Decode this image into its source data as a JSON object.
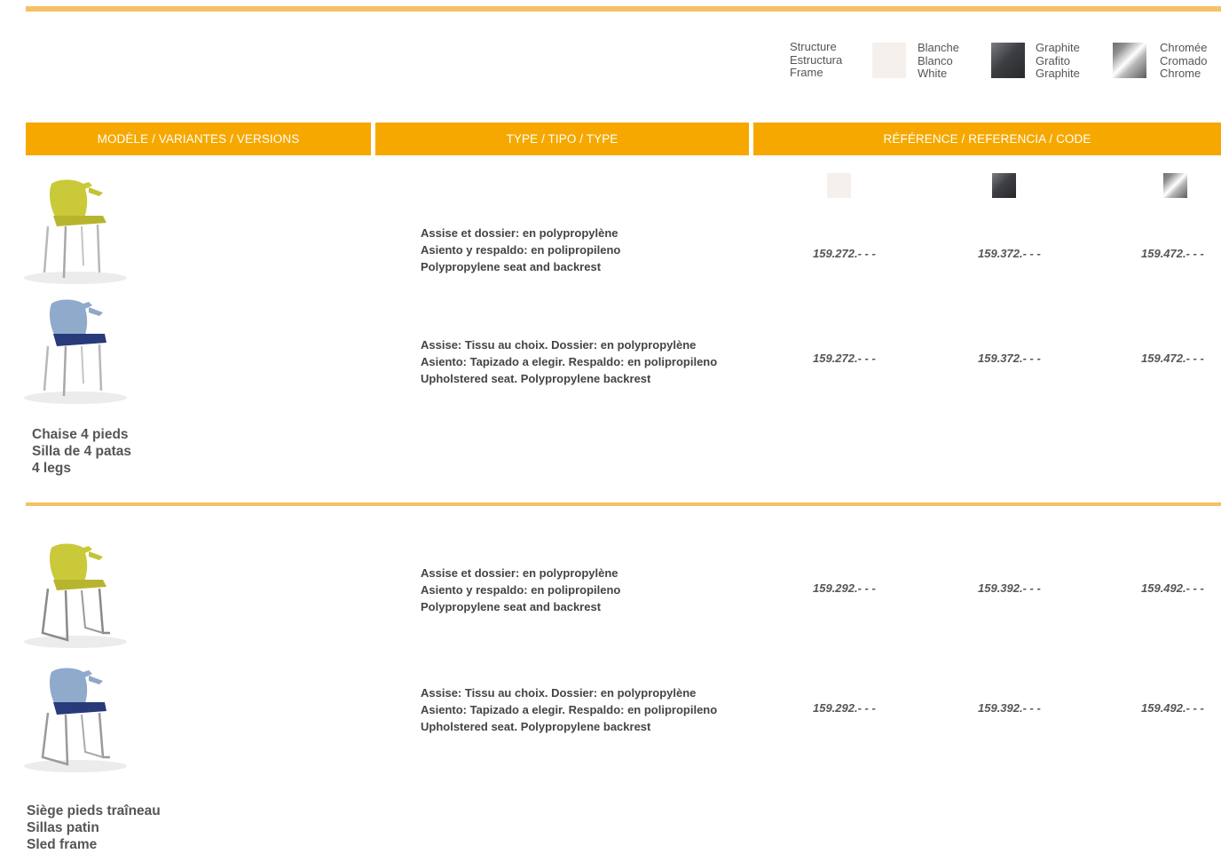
{
  "legend": {
    "structure": [
      "Structure",
      "Estructura",
      "Frame"
    ],
    "white": [
      "Blanche",
      "Blanco",
      "White"
    ],
    "graphite": [
      "Graphite",
      "Grafito",
      "Graphite"
    ],
    "chrome": [
      "Chromée",
      "Cromado",
      "Chrome"
    ],
    "colors": {
      "white": "#f6f0ec",
      "graphite": "#3e3f43",
      "chrome": "#b9b9b9",
      "accent": "#f6a800",
      "rule": "#f5c066"
    }
  },
  "headers": {
    "model": "MODÈLE / VARIANTES / VERSIONS",
    "type": "TYPE / TIPO / TYPE",
    "ref": "RÉFÉRENCE / REFERENCIA / CODE"
  },
  "sections": [
    {
      "name": [
        "Chaise 4 pieds",
        "Silla de 4 patas",
        "4 legs"
      ],
      "rows": [
        {
          "image": "yellow-4-leg-chair",
          "desc": [
            "Assise et dossier: en polypropylène",
            "Asiento y respaldo: en polipropileno",
            "Polypropylene seat and backrest"
          ],
          "refs": [
            "159.272.- - -",
            "159.372.- - -",
            "159.472.- - -"
          ]
        },
        {
          "image": "blue-4-leg-upholstered-chair",
          "desc": [
            "Assise: Tissu au choix. Dossier: en polypropylène",
            "Asiento: Tapizado a elegir. Respaldo: en polipropileno",
            "Upholstered seat. Polypropylene backrest"
          ],
          "refs": [
            "159.272.- - -",
            "159.372.- - -",
            "159.472.- - -"
          ]
        }
      ]
    },
    {
      "name": [
        "Siège pieds traîneau",
        "Sillas patin",
        "Sled frame"
      ],
      "rows": [
        {
          "image": "yellow-sled-chair",
          "desc": [
            "Assise et dossier: en polypropylène",
            "Asiento y respaldo: en polipropileno",
            "Polypropylene seat and backrest"
          ],
          "refs": [
            "159.292.- - -",
            "159.392.- - -",
            "159.492.- - -"
          ]
        },
        {
          "image": "blue-sled-upholstered-chair",
          "desc": [
            "Assise: Tissu au choix. Dossier: en polypropylène",
            "Asiento: Tapizado a elegir. Respaldo: en polipropileno",
            "Upholstered seat. Polypropylene backrest"
          ],
          "refs": [
            "159.292.- - -",
            "159.392.- - -",
            "159.492.- - -"
          ]
        }
      ]
    }
  ]
}
